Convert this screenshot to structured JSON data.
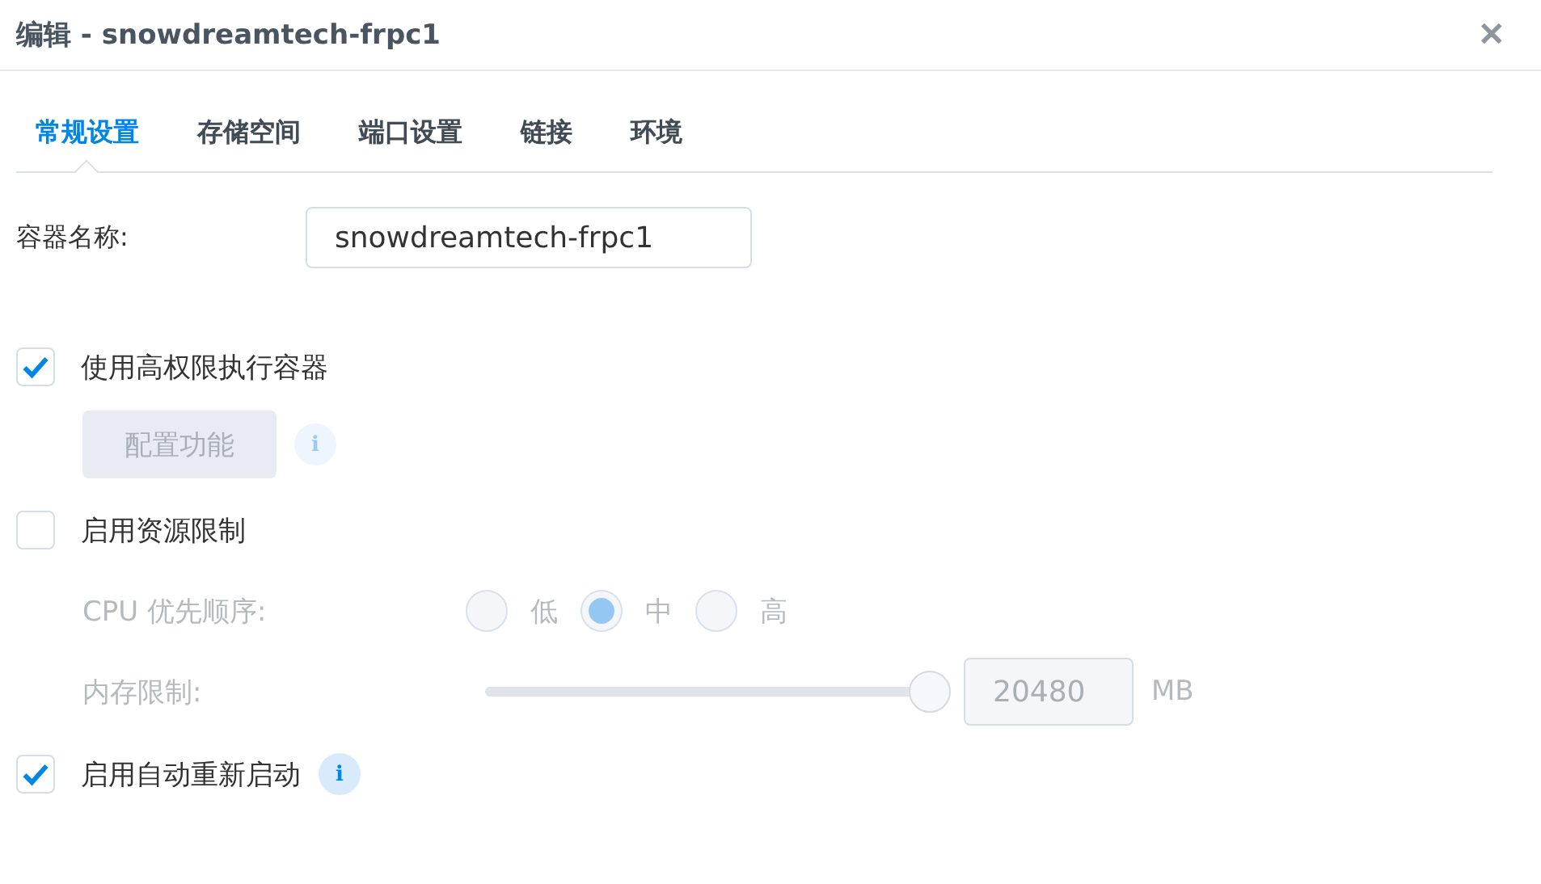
{
  "window": {
    "title": "编辑 - snowdreamtech-frpc1",
    "close": "✕"
  },
  "tabs": [
    {
      "label": "常规设置",
      "selected": true
    },
    {
      "label": "存储空间",
      "selected": false
    },
    {
      "label": "端口设置",
      "selected": false
    },
    {
      "label": "链接",
      "selected": false
    },
    {
      "label": "环境",
      "selected": false
    }
  ],
  "name_field": {
    "label": "容器名称:",
    "value": "snowdreamtech-frpc1"
  },
  "privileged": {
    "label": "使用高权限执行容器",
    "checked": true,
    "button": {
      "label": "配置功能",
      "disabled": true
    },
    "info": "i",
    "info_disabled": true
  },
  "resource_limit": {
    "label": "启用资源限制",
    "checked": false,
    "cpu": {
      "label": "CPU 优先顺序:",
      "disabled": true,
      "options": [
        {
          "label": "低",
          "selected": false
        },
        {
          "label": "中",
          "selected": true
        },
        {
          "label": "高",
          "selected": false
        }
      ]
    },
    "memory": {
      "label": "内存限制:",
      "disabled": true,
      "level": 1,
      "value": "20480",
      "unit": "MB"
    }
  },
  "auto_restart": {
    "label": "启用自动重新启动",
    "checked": true,
    "info": "i",
    "info_disabled": false
  }
}
